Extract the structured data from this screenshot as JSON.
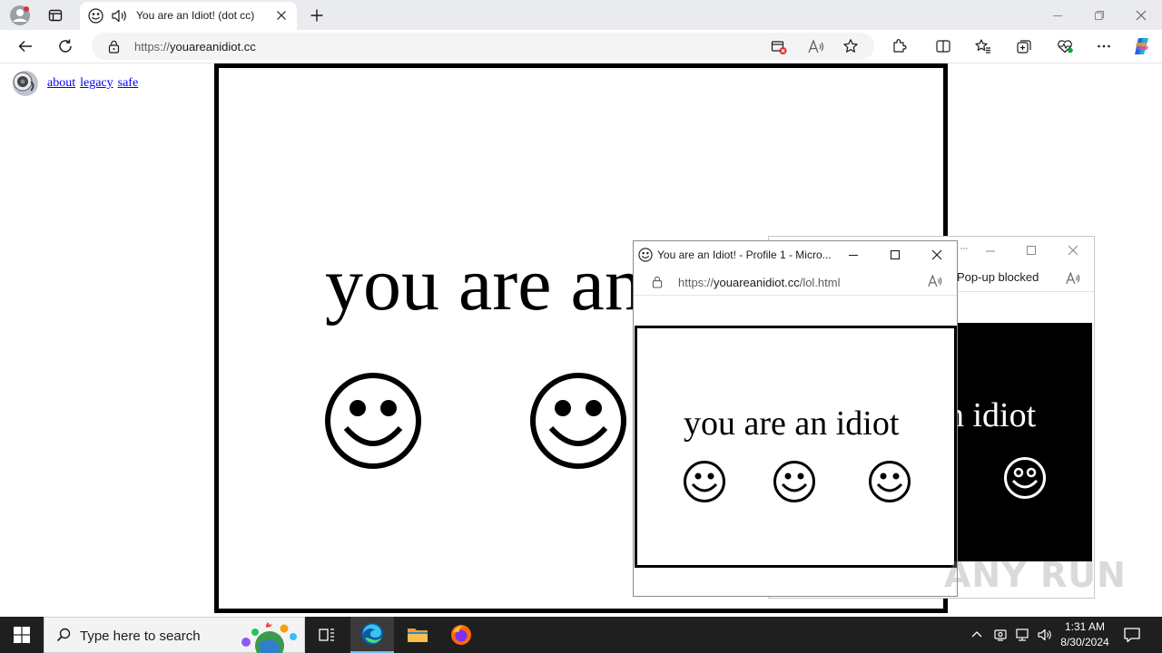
{
  "browser": {
    "tab_title": "You are an Idiot! (dot cc)",
    "url_host": "youareanidiot.cc",
    "url_scheme": "https://",
    "new_tab_symbol": "+"
  },
  "page": {
    "links": [
      {
        "label": "about"
      },
      {
        "label": "legacy"
      },
      {
        "label": "safe"
      }
    ],
    "big_text": "you are an"
  },
  "popup_back": {
    "status": "Pop-up blocked",
    "visible_text": "n idiot"
  },
  "popup_front": {
    "title": "You are an Idiot! - Profile 1 - Micro...",
    "url_scheme": "https://",
    "url_host": "youareanidiot.cc",
    "url_path": "/lol.html",
    "text": "you are an idiot"
  },
  "watermark": "ANY RUN",
  "taskbar": {
    "search_placeholder": "Type here to search",
    "time": "1:31 AM",
    "date": "8/30/2024"
  },
  "colors": {
    "tabbar_bg": "#e9ebee",
    "link": "#0000ee",
    "taskbar_bg": "#1f1f1f",
    "edge_blue": "#0c59a4"
  }
}
